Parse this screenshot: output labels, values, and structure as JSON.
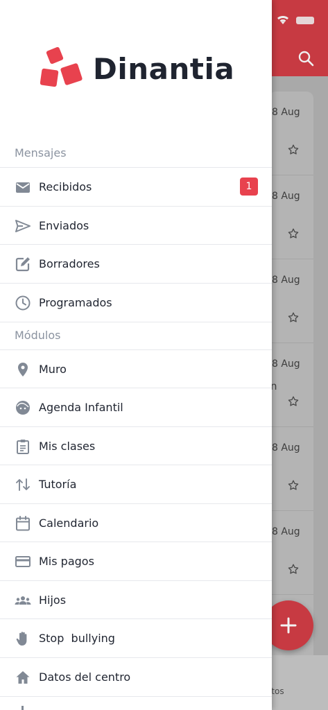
{
  "background": {
    "dates": [
      "8 Aug",
      "8 Aug",
      "8 Aug",
      "8 Aug",
      "8 Aug",
      "8 Aug"
    ],
    "partial_text": "n",
    "bottom_tab_partial": "ritos",
    "fab_icon": "plus-icon",
    "accent": "#c73a42"
  },
  "drawer": {
    "brand": "Dinantia",
    "brand_color": "#e8424e",
    "sections": {
      "messages": "Mensajes",
      "modules": "Módulos"
    },
    "messages": [
      {
        "label": "Recibidos",
        "icon": "inbox-icon",
        "badge": "1"
      },
      {
        "label": "Enviados",
        "icon": "send-icon"
      },
      {
        "label": "Borradores",
        "icon": "edit-icon"
      },
      {
        "label": "Programados",
        "icon": "clock-icon"
      }
    ],
    "modules": [
      {
        "label": "Muro",
        "icon": "location-pin-icon"
      },
      {
        "label": "Agenda Infantil",
        "icon": "child-face-icon"
      },
      {
        "label": "Mis clases",
        "icon": "clipboard-icon"
      },
      {
        "label": "Tutoría",
        "icon": "swap-arrows-icon"
      },
      {
        "label": "Calendario",
        "icon": "calendar-icon"
      },
      {
        "label": "Mis pagos",
        "icon": "credit-card-icon"
      },
      {
        "label": "Hijos",
        "icon": "people-icon"
      },
      {
        "label": "Stop  bullying",
        "icon": "hand-icon"
      },
      {
        "label": "Datos del centro",
        "icon": "home-icon"
      }
    ]
  }
}
